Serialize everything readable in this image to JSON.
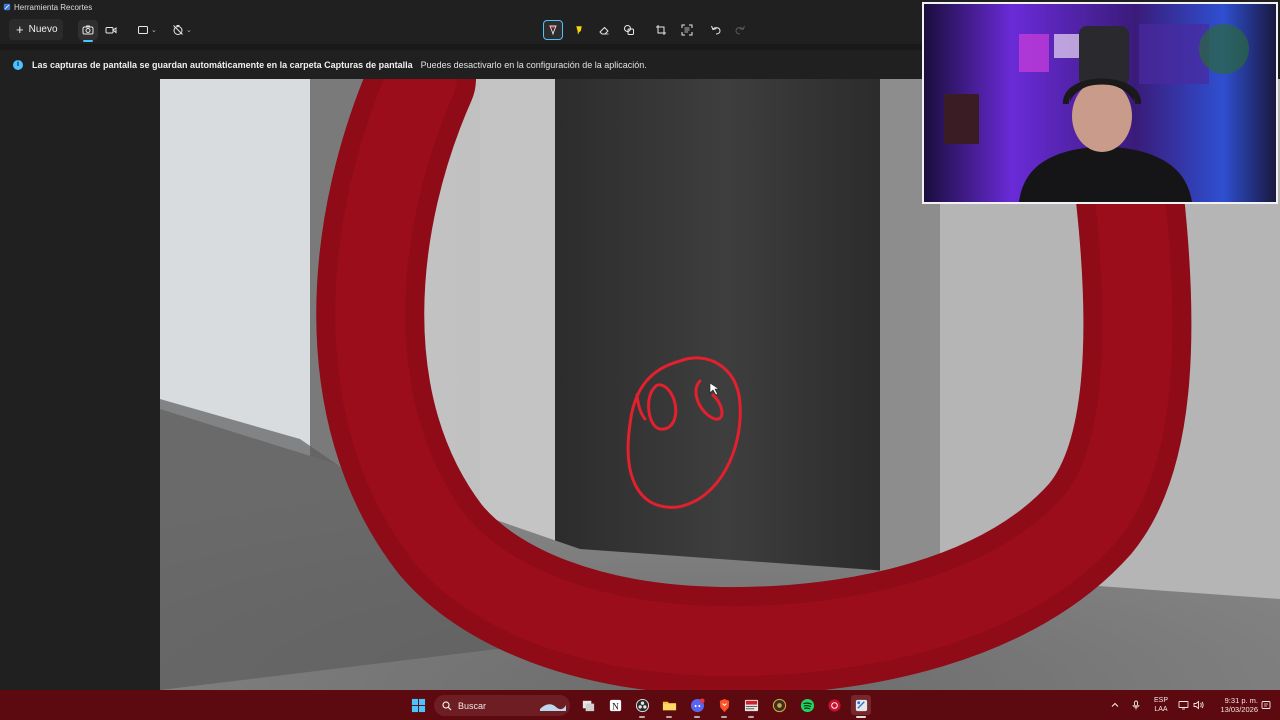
{
  "window": {
    "title": "Herramienta Recortes"
  },
  "toolbar": {
    "new_label": "Nuevo",
    "new_icon": "plus-icon",
    "tools": [
      {
        "name": "screenshot-mode",
        "icon": "camera-icon",
        "selected": true
      },
      {
        "name": "video-mode",
        "icon": "video-icon"
      },
      {
        "name": "snip-shape",
        "icon": "rectangle-icon"
      },
      {
        "name": "delay",
        "icon": "timer-off-icon"
      },
      {
        "name": "ballpoint-pen",
        "icon": "pen-icon",
        "selected": true,
        "color": "#e4202f"
      },
      {
        "name": "highlighter",
        "icon": "highlighter-icon",
        "color": "#ffd400"
      },
      {
        "name": "eraser",
        "icon": "eraser-icon"
      },
      {
        "name": "shapes",
        "icon": "shapes-icon"
      },
      {
        "name": "crop",
        "icon": "crop-icon"
      },
      {
        "name": "text-actions",
        "icon": "text-actions-icon"
      },
      {
        "name": "undo",
        "icon": "undo-icon"
      },
      {
        "name": "redo",
        "icon": "redo-icon",
        "disabled": true
      }
    ]
  },
  "infobar": {
    "icon": "info-icon",
    "title": "Las capturas de pantalla se guardan automáticamente en la carpeta Capturas de pantalla",
    "description": "Puedes desactivarlo en la configuración de la aplicación."
  },
  "canvas": {
    "annotation_color": "#e4202f",
    "marker_color": "#8e0b17"
  },
  "taskbar": {
    "search_placeholder": "Buscar",
    "apps": [
      "windows-start-icon",
      "search-icon",
      "widget-icon",
      "task-view-icon",
      "notion-icon",
      "obs-icon",
      "file-explorer-icon",
      "discord-icon",
      "brave-icon",
      "news-icon",
      "app-icon",
      "spotify-icon",
      "app-red-icon",
      "snipping-tool-icon"
    ],
    "language_top": "ESP",
    "language_bottom": "LAA",
    "time": "9:31 p. m.",
    "date": "13/03/2026",
    "accent": "#5c0a0f"
  }
}
